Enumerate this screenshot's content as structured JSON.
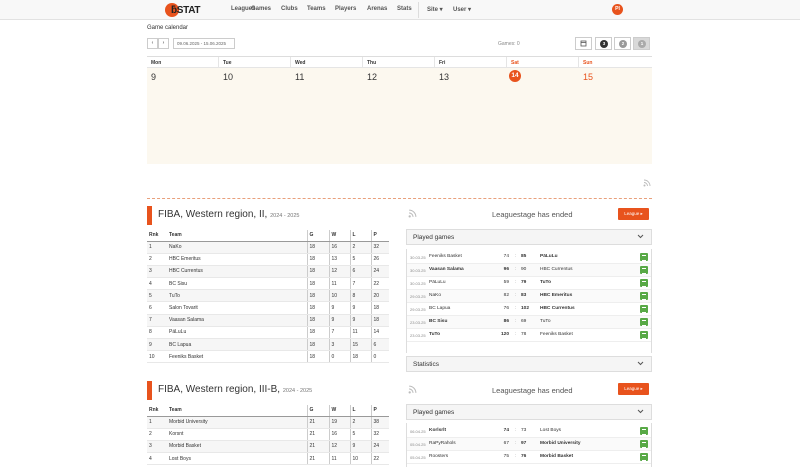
{
  "navbar": {
    "logo_text": "ƃSTAT",
    "items": [
      "Leagues",
      "Games",
      "Clubs",
      "Teams",
      "Players",
      "Arenas",
      "Stats"
    ],
    "site_label": "Site ▾",
    "user_label": "User ▾",
    "avatar_initials": "PI",
    "accent": "#e8531d"
  },
  "calendar": {
    "title": "Game calendar",
    "prev_icon": "‹",
    "next_icon": "›",
    "date_range": "09.06.2025 - 15.06.2025",
    "games_count": "Games: 0",
    "view_buttons": [
      "3",
      "2",
      "1"
    ],
    "days": [
      {
        "name": "Mon",
        "num": "9"
      },
      {
        "name": "Tue",
        "num": "10"
      },
      {
        "name": "Wed",
        "num": "11"
      },
      {
        "name": "Thu",
        "num": "12"
      },
      {
        "name": "Fri",
        "num": "13"
      },
      {
        "name": "Sat",
        "num": "14"
      },
      {
        "name": "Sun",
        "num": "15"
      }
    ]
  },
  "leagues": [
    {
      "title": "FIBA, Western region, II,",
      "season": "2024 - 2025",
      "stage_text": "Leaguestage has ended",
      "league_button": "League ▸",
      "headers": [
        "Rnk",
        "Team",
        "G",
        "W",
        "L",
        "P"
      ],
      "rows": [
        [
          "1",
          "NaKo",
          "18",
          "16",
          "2",
          "32"
        ],
        [
          "2",
          "HBC Emeritus",
          "18",
          "13",
          "5",
          "26"
        ],
        [
          "3",
          "HBC Currentus",
          "18",
          "12",
          "6",
          "24"
        ],
        [
          "4",
          "BC Sisu",
          "18",
          "11",
          "7",
          "22"
        ],
        [
          "5",
          "TuTo",
          "18",
          "10",
          "8",
          "20"
        ],
        [
          "6",
          "Salon Tovarit",
          "18",
          "9",
          "9",
          "18"
        ],
        [
          "7",
          "Vaasan Salama",
          "18",
          "9",
          "9",
          "18"
        ],
        [
          "8",
          "PäLuLu",
          "18",
          "7",
          "11",
          "14"
        ],
        [
          "9",
          "BC Lapua",
          "18",
          "3",
          "15",
          "6"
        ],
        [
          "10",
          "Feeniks Basket",
          "18",
          "0",
          "18",
          "0"
        ]
      ],
      "played_games_label": "Played games",
      "statistics_label": "Statistics",
      "games": [
        {
          "date": "30.03.25",
          "home": "Feeniks Basket",
          "hs": "74",
          "as": "85",
          "away": "PäLuLu",
          "winner": "away"
        },
        {
          "date": "30.03.25",
          "home": "Vaasan Salama",
          "hs": "96",
          "as": "90",
          "away": "HBC Currentus",
          "winner": "home"
        },
        {
          "date": "30.03.25",
          "home": "PäLuLu",
          "hs": "59",
          "as": "79",
          "away": "TuTo",
          "winner": "away"
        },
        {
          "date": "29.03.25",
          "home": "NaKo",
          "hs": "82",
          "as": "83",
          "away": "HBC Emeritus",
          "winner": "away"
        },
        {
          "date": "29.03.25",
          "home": "BC Lapua",
          "hs": "76",
          "as": "102",
          "away": "HBC Currentus",
          "winner": "away"
        },
        {
          "date": "23.03.25",
          "home": "BC Sisu",
          "hs": "86",
          "as": "69",
          "away": "TuTo",
          "winner": "home"
        },
        {
          "date": "23.03.25",
          "home": "TuTo",
          "hs": "120",
          "as": "78",
          "away": "Feeniks Basket",
          "winner": "home"
        }
      ]
    },
    {
      "title": "FIBA, Western region, III-B,",
      "season": "2024 - 2025",
      "stage_text": "Leaguestage has ended",
      "league_button": "League ▸",
      "headers": [
        "Rnk",
        "Team",
        "G",
        "W",
        "L",
        "P"
      ],
      "rows": [
        [
          "1",
          "Morbid University",
          "21",
          "19",
          "2",
          "38"
        ],
        [
          "2",
          "Korsnt",
          "21",
          "16",
          "5",
          "32"
        ],
        [
          "3",
          "Morbid Basket",
          "21",
          "12",
          "9",
          "24"
        ],
        [
          "4",
          "Lost Boys",
          "21",
          "11",
          "10",
          "22"
        ]
      ],
      "played_games_label": "Played games",
      "games": [
        {
          "date": "06.04.25",
          "home": "Korlsrlt",
          "hs": "74",
          "as": "73",
          "away": "Lost Boys",
          "winner": "home"
        },
        {
          "date": "05.04.25",
          "home": "RaPyRahols",
          "hs": "67",
          "as": "97",
          "away": "Morbid University",
          "winner": "away"
        },
        {
          "date": "05.04.25",
          "home": "Roosters",
          "hs": "75",
          "as": "76",
          "away": "Morbid Basket",
          "winner": "away"
        }
      ]
    }
  ]
}
